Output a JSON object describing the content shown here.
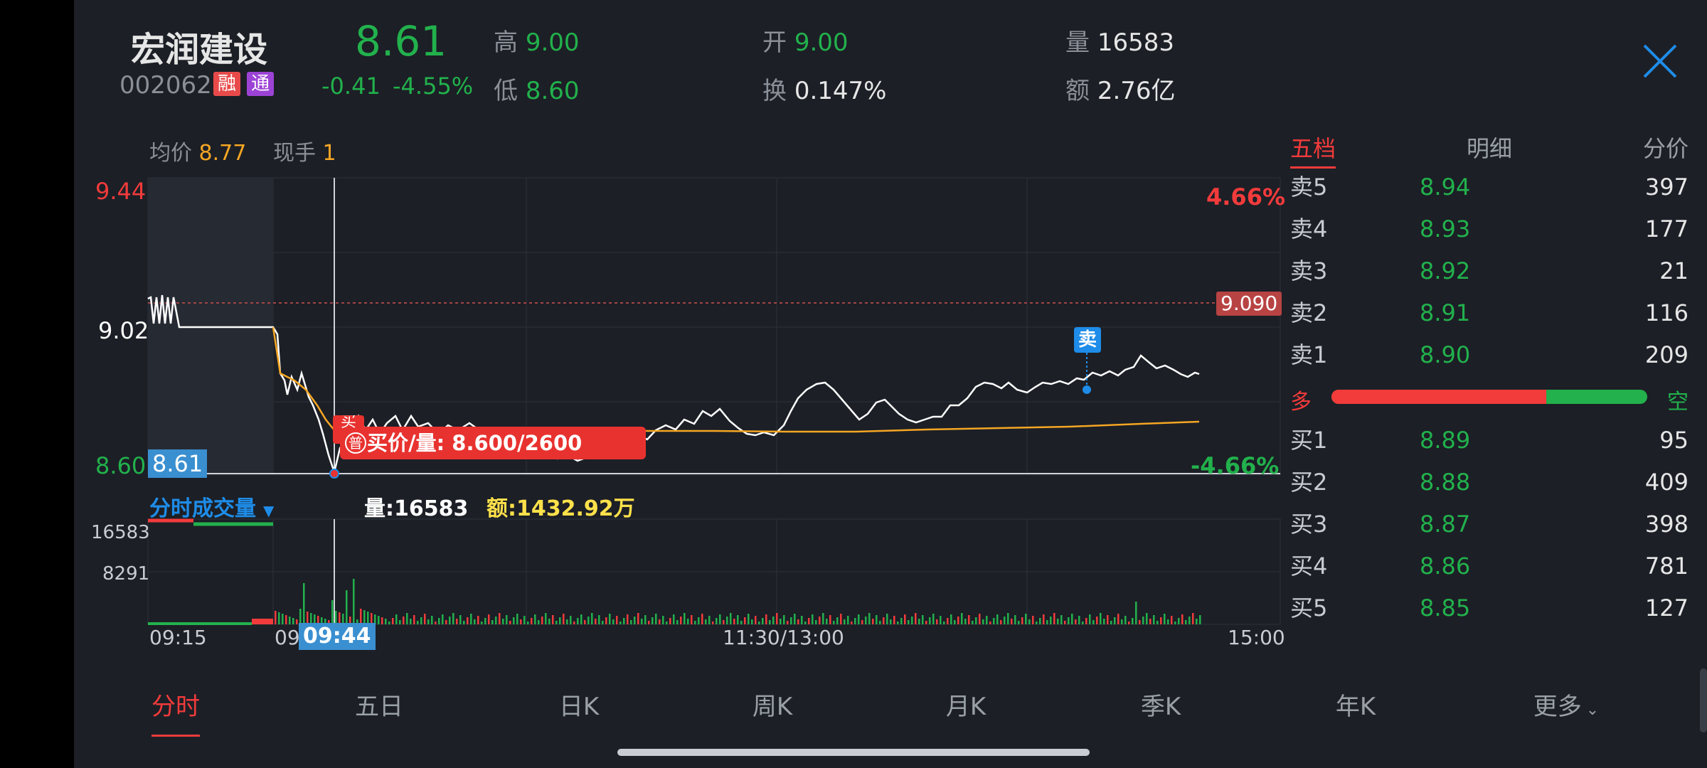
{
  "stock": {
    "name": "宏润建设",
    "code": "002062",
    "tag_margin": "融",
    "tag_connect": "通",
    "price": "8.61",
    "change": "-0.41",
    "change_pct": "-4.55%"
  },
  "stats": {
    "high_label": "高",
    "high": "9.00",
    "low_label": "低",
    "low": "8.60",
    "open_label": "开",
    "open": "9.00",
    "turnover_label": "换",
    "turnover": "0.147%",
    "volume_label": "量",
    "volume": "16583",
    "amount_label": "额",
    "amount": "2.76亿"
  },
  "chart_info": {
    "avg_label": "均价",
    "avg": "8.77",
    "cur_hand_label": "现手",
    "cur_hand": "1"
  },
  "price_axis": {
    "top": "9.44",
    "mid": "9.02",
    "bottom": "8.60",
    "top_pct": "4.66%",
    "bottom_pct": "-4.66%",
    "ref_line": "9.090",
    "cursor_price": "8.61"
  },
  "markers": {
    "sell": "卖",
    "buy": "买",
    "tooltip_tag": "普",
    "tooltip": "买价/量: 8.600/2600"
  },
  "volume_panel": {
    "title": "分时成交量",
    "vol_label": "量:",
    "vol": "16583",
    "amt_label": "额:",
    "amt": "1432.92万",
    "max": "16583",
    "mid": "8291"
  },
  "time_axis": {
    "start": "09:15",
    "partial": "09",
    "cursor": "09:44",
    "midday": "11:30/13:00",
    "end": "15:00"
  },
  "order_book": {
    "tabs": [
      "五档",
      "明细",
      "分价"
    ],
    "asks": [
      {
        "label": "卖5",
        "price": "8.94",
        "vol": "397"
      },
      {
        "label": "卖4",
        "price": "8.93",
        "vol": "177"
      },
      {
        "label": "卖3",
        "price": "8.92",
        "vol": "21"
      },
      {
        "label": "卖2",
        "price": "8.91",
        "vol": "116"
      },
      {
        "label": "卖1",
        "price": "8.90",
        "vol": "209"
      }
    ],
    "bull_label": "多",
    "bear_label": "空",
    "bull_ratio": 0.68,
    "bids": [
      {
        "label": "买1",
        "price": "8.89",
        "vol": "95"
      },
      {
        "label": "买2",
        "price": "8.88",
        "vol": "409"
      },
      {
        "label": "买3",
        "price": "8.87",
        "vol": "398"
      },
      {
        "label": "买4",
        "price": "8.86",
        "vol": "781"
      },
      {
        "label": "买5",
        "price": "8.85",
        "vol": "127"
      }
    ]
  },
  "bottom_tabs": [
    "分时",
    "五日",
    "日K",
    "周K",
    "月K",
    "季K",
    "年K",
    "更多"
  ],
  "colors": {
    "up": "#f23b3b",
    "down": "#22b14c",
    "avg_line": "#f5a623",
    "accent": "#1e8ce8"
  },
  "chart_data": {
    "type": "line",
    "series": [
      {
        "name": "均价",
        "values": [
          9.0,
          8.84,
          8.75,
          8.72,
          8.7,
          8.7,
          8.71,
          8.72,
          8.73,
          8.73,
          8.74
        ]
      }
    ],
    "ylim": [
      8.6,
      9.44
    ]
  }
}
